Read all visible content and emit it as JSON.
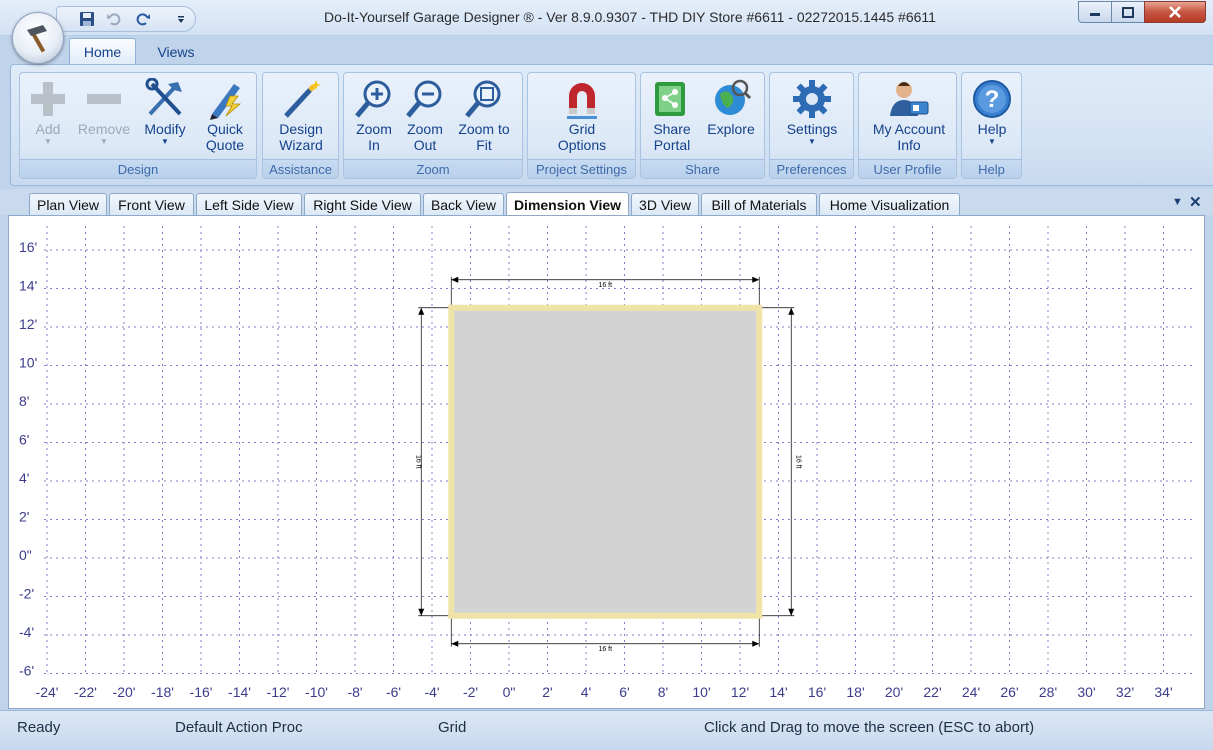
{
  "window": {
    "title": "Do-It-Yourself Garage Designer ® - Ver 8.9.0.9307 - THD DIY Store #6611 - 02272015.1445 #6611"
  },
  "quick_access": [
    {
      "icon": "save-icon"
    },
    {
      "icon": "undo-icon"
    },
    {
      "icon": "redo-icon"
    },
    {
      "icon": "customize-dropdown-icon"
    }
  ],
  "ribbon": {
    "tabs": [
      {
        "label": "Home",
        "active": true
      },
      {
        "label": "Views",
        "active": false
      }
    ],
    "groups": {
      "design": {
        "label": "Design",
        "buttons": {
          "add": {
            "line1": "Add",
            "line2": "",
            "enabled": false,
            "icon": "plus-icon"
          },
          "remove": {
            "line1": "Remove",
            "line2": "",
            "enabled": false,
            "icon": "minus-icon"
          },
          "modify": {
            "line1": "Modify",
            "line2": "",
            "enabled": true,
            "icon": "hammer-wrench-icon"
          },
          "quick_quote": {
            "line1": "Quick",
            "line2": "Quote",
            "enabled": true,
            "icon": "pencil-lightning-icon"
          }
        }
      },
      "assistance": {
        "label": "Assistance",
        "buttons": {
          "design_wizard": {
            "line1": "Design",
            "line2": "Wizard",
            "icon": "magic-wand-icon"
          }
        }
      },
      "zoom": {
        "label": "Zoom",
        "buttons": {
          "zoom_in": {
            "line1": "Zoom",
            "line2": "In",
            "icon": "zoom-in-icon"
          },
          "zoom_out": {
            "line1": "Zoom",
            "line2": "Out",
            "icon": "zoom-out-icon"
          },
          "zoom_fit": {
            "line1": "Zoom to",
            "line2": "Fit",
            "icon": "zoom-fit-icon"
          }
        }
      },
      "project_settings": {
        "label": "Project Settings",
        "buttons": {
          "grid_options": {
            "line1": "Grid",
            "line2": "Options",
            "icon": "magnet-icon"
          }
        }
      },
      "share": {
        "label": "Share",
        "buttons": {
          "share_portal": {
            "line1": "Share",
            "line2": "Portal",
            "icon": "share-icon"
          },
          "explore": {
            "line1": "Explore",
            "line2": "",
            "icon": "globe-icon"
          }
        }
      },
      "preferences": {
        "label": "Preferences",
        "buttons": {
          "settings": {
            "line1": "Settings",
            "line2": "",
            "icon": "gear-icon"
          }
        }
      },
      "user_profile": {
        "label": "User Profile",
        "buttons": {
          "my_account": {
            "line1": "My Account",
            "line2": "Info",
            "icon": "user-card-icon"
          }
        }
      },
      "help": {
        "label": "Help",
        "buttons": {
          "help": {
            "line1": "Help",
            "line2": "",
            "icon": "help-icon"
          }
        }
      }
    }
  },
  "view_tabs": [
    {
      "label": "Plan View",
      "active": false
    },
    {
      "label": "Front View",
      "active": false
    },
    {
      "label": "Left Side View",
      "active": false
    },
    {
      "label": "Right Side View",
      "active": false
    },
    {
      "label": "Back View",
      "active": false
    },
    {
      "label": "Dimension View",
      "active": true
    },
    {
      "label": "3D View",
      "active": false
    },
    {
      "label": "Bill of Materials",
      "active": false
    },
    {
      "label": "Home Visualization",
      "active": false
    }
  ],
  "drawing": {
    "y_axis_labels": [
      "16'",
      "14'",
      "12'",
      "10'",
      "8'",
      "6'",
      "4'",
      "2'",
      "0\"",
      "-2'",
      "-4'",
      "-6'"
    ],
    "x_axis_labels": [
      "-24'",
      "-22'",
      "-20'",
      "-18'",
      "-16'",
      "-14'",
      "-12'",
      "-10'",
      "-8'",
      "-6'",
      "-4'",
      "-2'",
      "0\"",
      "2'",
      "4'",
      "6'",
      "8'",
      "10'",
      "12'",
      "14'",
      "16'",
      "18'",
      "20'",
      "22'",
      "24'",
      "26'",
      "28'",
      "30'",
      "32'",
      "34'"
    ],
    "garage": {
      "x_min_ft": -3,
      "x_max_ft": 13,
      "y_min_ft": -3,
      "y_max_ft": 13,
      "fill": "#d3d3d3",
      "wall_color": "#f0e3a8"
    },
    "dimensions": {
      "top": "16 ft",
      "bottom": "16 ft",
      "left": "16 ft",
      "right": "16 ft"
    },
    "grid_color": "#8080c8",
    "axis_label_color": "#3c3c8c"
  },
  "status_bar": {
    "state": "Ready",
    "action": "Default Action Proc",
    "mode": "Grid",
    "hint": "Click and Drag to move the screen  (ESC to abort)"
  }
}
